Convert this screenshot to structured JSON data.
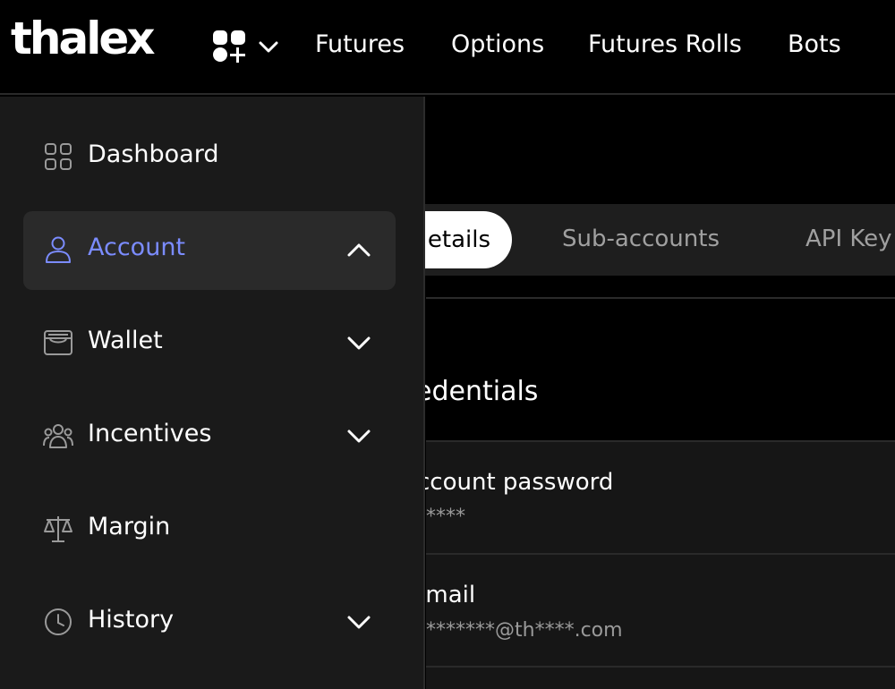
{
  "brand": {
    "logo_text": "thalex"
  },
  "topnav": {
    "links": [
      "Futures",
      "Options",
      "Futures Rolls",
      "Bots"
    ]
  },
  "sidebar": {
    "items": [
      {
        "label": "Dashboard",
        "icon": "grid-icon",
        "expandable": false
      },
      {
        "label": "Account",
        "icon": "user-icon",
        "expandable": true,
        "expanded": true,
        "active": true
      },
      {
        "label": "Wallet",
        "icon": "wallet-icon",
        "expandable": true
      },
      {
        "label": "Incentives",
        "icon": "group-icon",
        "expandable": true
      },
      {
        "label": "Margin",
        "icon": "scale-icon",
        "expandable": false
      },
      {
        "label": "History",
        "icon": "clock-icon",
        "expandable": true
      }
    ]
  },
  "tabs": {
    "active": "etails",
    "items": [
      "Sub-accounts",
      "API Key"
    ]
  },
  "credentials": {
    "title": "edentials",
    "fields": [
      {
        "label": "ccount password",
        "value": "****"
      },
      {
        "label": "-mail",
        "value": "*******@th****.com"
      }
    ]
  },
  "colors": {
    "accent": "#7b8cff",
    "sidebar_bg": "#1a1a1a",
    "active_item_bg": "#2a2a2a",
    "background": "#000000"
  }
}
